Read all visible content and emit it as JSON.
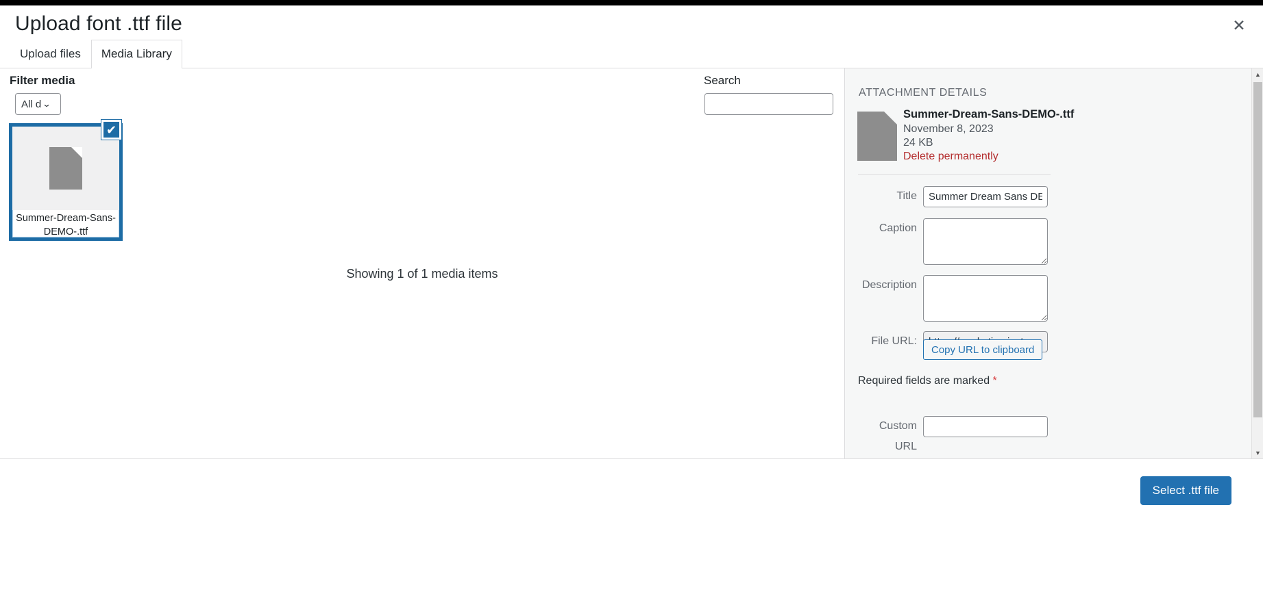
{
  "modal": {
    "title": "Upload font .ttf file",
    "close_icon": "close-icon"
  },
  "tabs": [
    {
      "label": "Upload files",
      "active": false
    },
    {
      "label": "Media Library",
      "active": true
    }
  ],
  "toolbar": {
    "filter_label": "Filter media",
    "filter_value": "All d",
    "filter_full_value": "All dates",
    "chevron_icon": "chevron-down-icon",
    "search_label": "Search",
    "search_value": "",
    "search_placeholder": ""
  },
  "media": {
    "items": [
      {
        "filename": "Summer-Dream-Sans-DEMO-.ttf",
        "selected": true,
        "thumb_icon": "file-icon",
        "check_icon": "checkmark-icon"
      }
    ],
    "showing_text": "Showing 1 of 1 media items"
  },
  "sidebar": {
    "heading": "ATTACHMENT DETAILS",
    "file_icon": "file-icon",
    "filename": "Summer-Dream-Sans-DEMO-.ttf",
    "date": "November 8, 2023",
    "filesize": "24 KB",
    "delete_label": "Delete permanently",
    "fields": {
      "title_label": "Title",
      "title_value": "Summer Dream Sans DEM",
      "caption_label": "Caption",
      "caption_value": "",
      "description_label": "Description",
      "description_value": "",
      "file_url_label": "File URL:",
      "file_url_value": "https://marketing.instawp",
      "copy_url_label": "Copy URL to clipboard",
      "required_note": "Required fields are marked",
      "required_star": "*",
      "custom_url_label": "Custom URL",
      "custom_url_value": ""
    },
    "scroll_up_icon": "triangle-up-icon",
    "scroll_down_icon": "triangle-down-icon"
  },
  "footer": {
    "primary_button": "Select .ttf file"
  },
  "colors": {
    "accent": "#2271b1",
    "selected_border": "#1d6ca5",
    "danger": "#b32d2e",
    "sidebar_bg": "#f6f7f7"
  }
}
